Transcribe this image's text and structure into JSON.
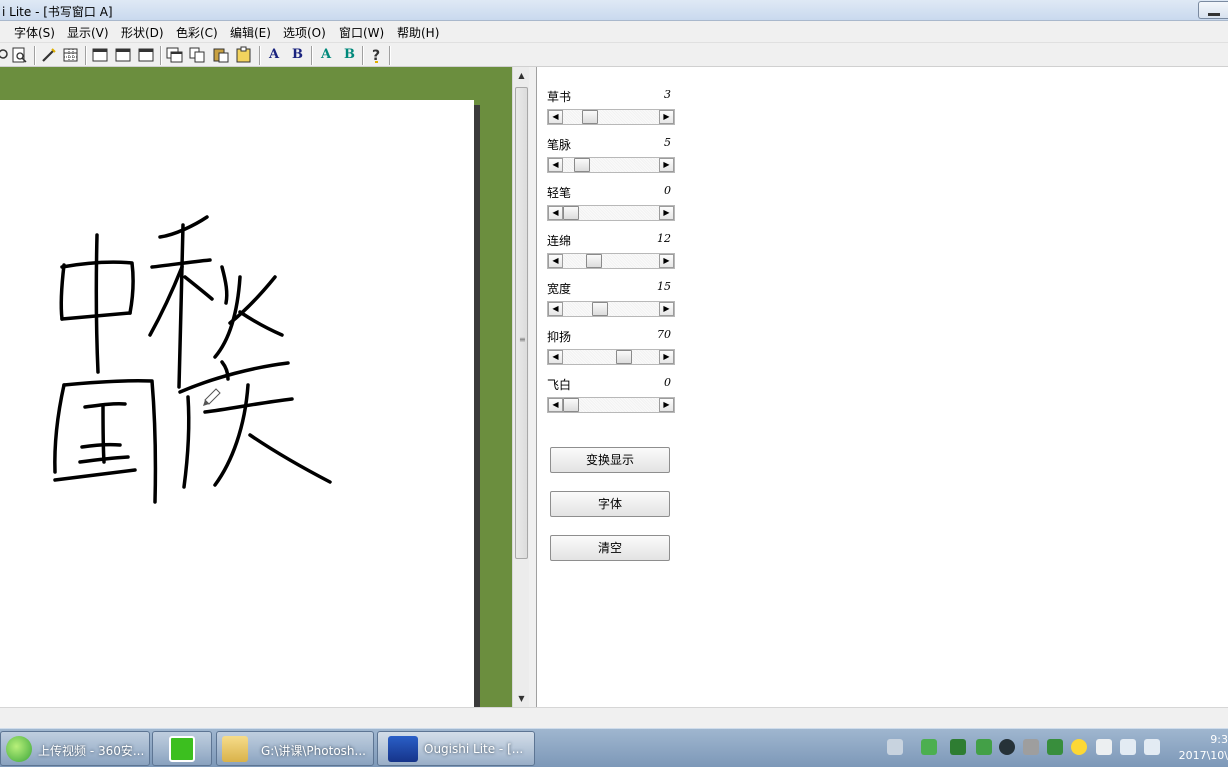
{
  "window": {
    "title": "i Lite - [书写窗口 A]"
  },
  "menu": [
    "字体(S)",
    "显示(V)",
    "形状(D)",
    "色彩(C)",
    "编辑(E)",
    "选项(O)",
    "窗口(W)",
    "帮助(H)"
  ],
  "toolbar": {
    "icons": [
      "preview-icon",
      "print-preview-icon",
      "pen-icon",
      "grid-icon",
      "window-1-icon",
      "window-2-icon",
      "window-3-icon",
      "new-window-icon",
      "copy-icon",
      "paste-icon",
      "clipboard-icon",
      "font-a-blue-icon",
      "font-b-blue-icon",
      "font-a-teal-icon",
      "font-b-teal-icon",
      "help-icon"
    ],
    "letters": {
      "a1": "A",
      "b1": "B",
      "a2": "A",
      "b2": "B"
    },
    "colors": {
      "navy": "#1a237e",
      "teal": "#00897b",
      "green": "#2e7d32",
      "cyan": "#0097a7"
    }
  },
  "canvas": {
    "background": "#6b8e3e",
    "paper": "#ffffff"
  },
  "params": [
    {
      "label": "草书",
      "value": "3",
      "position": 0.3
    },
    {
      "label": "笔脉",
      "value": "5",
      "position": 0.22
    },
    {
      "label": "轻笔",
      "value": "0",
      "position": 0.08
    },
    {
      "label": "连绵",
      "value": "12",
      "position": 0.38
    },
    {
      "label": "宽度",
      "value": "15",
      "position": 0.44
    },
    {
      "label": "抑扬",
      "value": "70",
      "position": 0.78
    },
    {
      "label": "飞白",
      "value": "0",
      "position": 0.08
    }
  ],
  "buttons": {
    "toggle_display": "变换显示",
    "font": "字体",
    "clear": "清空"
  },
  "taskbar": {
    "tasks": [
      {
        "label": "上传视频 - 360安...",
        "icon": "360-browser-icon"
      },
      {
        "label": "",
        "icon": "iqiyi-icon"
      },
      {
        "label": "G:\\讲课\\Photosh...",
        "icon": "folder-icon"
      },
      {
        "label": "Ougishi Lite - [...",
        "icon": "ougishi-app-icon"
      }
    ],
    "clock_time": "9:3",
    "clock_date": "2017\\10\\"
  }
}
